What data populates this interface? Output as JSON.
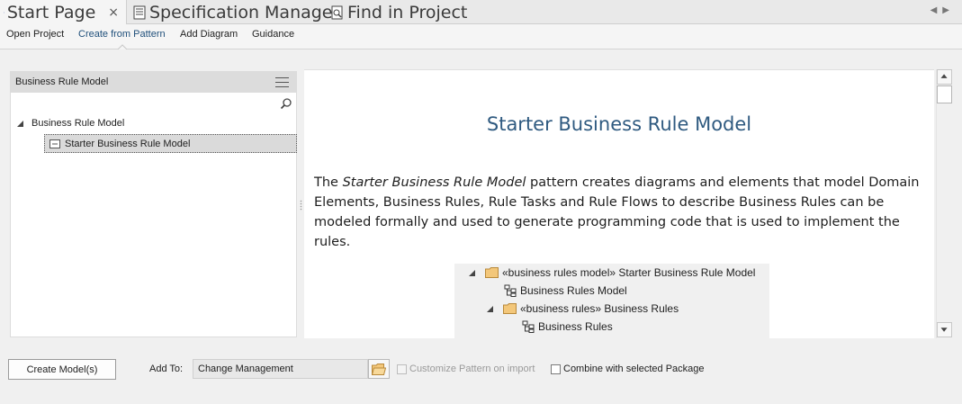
{
  "tabs": [
    {
      "label": "Start Page",
      "icon": "start-page-icon",
      "active": true,
      "closable": true
    },
    {
      "label": "Specification Manager",
      "icon": "specification-icon",
      "active": false
    },
    {
      "label": "Find in Project",
      "icon": "find-icon",
      "active": false
    }
  ],
  "tab_close_glyph": "×",
  "ribbon": {
    "items": [
      {
        "label": "Open Project"
      },
      {
        "label": "Create from Pattern",
        "active": true
      },
      {
        "label": "Add Diagram"
      },
      {
        "label": "Guidance"
      }
    ]
  },
  "left_panel": {
    "title": "Business Rule Model",
    "tree": {
      "root_label": "Business Rule Model",
      "child_label": "Starter Business Rule Model"
    }
  },
  "content": {
    "title": "Starter Business Rule Model",
    "para_lead": "The ",
    "para_em": "Starter Business Rule Model",
    "para_rest": " pattern creates diagrams and elements that model Domain Elements, Business Rules, Rule Tasks and Rule Flows to describe Business Rules can be modeled formally and used to generate programming code that is used to implement the rules.",
    "sample_tree": [
      {
        "label": "«business rules model» Starter Business Rule Model",
        "icon": "folder-icon",
        "expandable": true
      },
      {
        "label": "Business Rules Model",
        "icon": "diagram-icon",
        "expandable": false
      },
      {
        "label": "«business rules» Business Rules",
        "icon": "folder-icon",
        "expandable": true
      },
      {
        "label": "Business Rules",
        "icon": "diagram-icon",
        "expandable": false
      }
    ]
  },
  "bottom": {
    "create_button": "Create Model(s)",
    "add_to_label": "Add To:",
    "add_to_value": "Change Management",
    "customize_label": "Customize Pattern on import",
    "customize_checked": false,
    "customize_enabled": false,
    "combine_label": "Combine with selected Package",
    "combine_checked": false
  },
  "colors": {
    "accent": "#2f5a80",
    "tab_bar": "#e9e9e9",
    "folder": "#e8b35a"
  }
}
